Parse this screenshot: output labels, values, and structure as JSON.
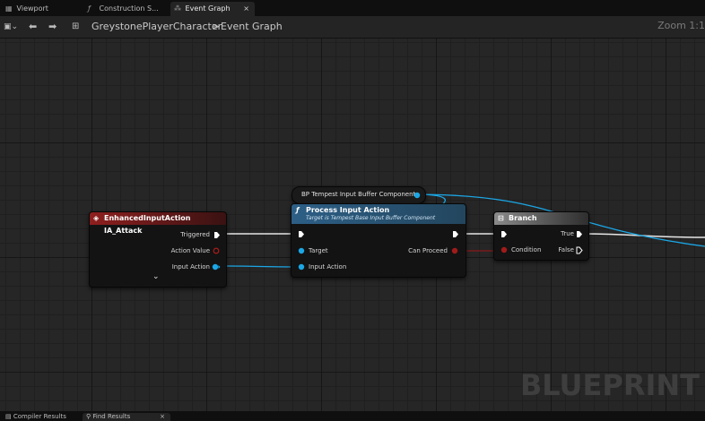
{
  "tabs": [
    {
      "label": "Viewport",
      "icon": "viewport-icon"
    },
    {
      "label": "Construction S...",
      "icon": "function-icon"
    },
    {
      "label": "Event Graph",
      "icon": "graph-icon",
      "close": "×"
    }
  ],
  "toolbar": {
    "breadcrumb_root": "GreystonePlayerCharacter",
    "separator": ">",
    "breadcrumb_current": "Event Graph",
    "zoom": "Zoom 1:1"
  },
  "nodes": {
    "input_action": {
      "title": "EnhancedInputAction IA_Attack",
      "pins": {
        "triggered": "Triggered",
        "action_value": "Action Value",
        "input_action": "Input Action"
      },
      "expand": "⌄"
    },
    "component_var": {
      "title": "BP Tempest Input Buffer Component"
    },
    "process": {
      "title": "Process Input Action",
      "subtitle": "Target is Tempest Base Input Buffer Component",
      "pins": {
        "target": "Target",
        "input_action": "Input Action",
        "can_proceed": "Can Proceed"
      }
    },
    "branch": {
      "title": "Branch",
      "pins": {
        "condition": "Condition",
        "true": "True",
        "false": "False"
      }
    }
  },
  "watermark": "BLUEPRINT",
  "bottom_tabs": [
    {
      "label": "Compiler Results"
    },
    {
      "label": "Find Results",
      "close": "×"
    }
  ],
  "colors": {
    "event_header": "#7a1a1a",
    "function_header": "#2d5f86",
    "object_pin": "#1ba7e6",
    "bool_pin": "#a11b1b",
    "exec_pin": "#ffffff"
  }
}
